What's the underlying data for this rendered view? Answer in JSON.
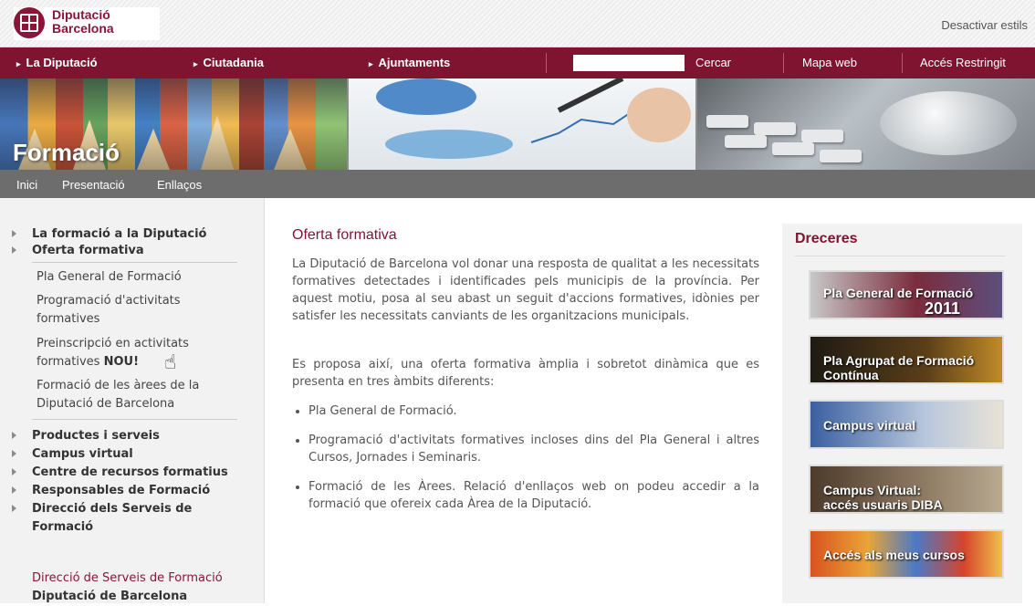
{
  "header": {
    "logo_line1": "Diputació",
    "logo_line2": "Barcelona",
    "desactivar": "Desactivar estils"
  },
  "nav": {
    "items": [
      "La Diputació",
      "Ciutadania",
      "Ajuntaments"
    ],
    "search_label": "Cercar",
    "mapa": "Mapa web",
    "acces": "Accés Restringit"
  },
  "banner": {
    "title": "Formació"
  },
  "subnav": [
    "Inici",
    "Presentació",
    "Enllaços"
  ],
  "sidebar": {
    "top": [
      "La formació a la Diputació",
      "Oferta formativa"
    ],
    "sub": [
      "Pla General de Formació",
      "Programació d'activitats",
      "formatives",
      "Preinscripció en activitats",
      "formatives",
      "NOU!",
      "Formació de les àrees de la",
      "Diputació de Barcelona"
    ],
    "more": [
      "Productes i serveis",
      "Campus virtual",
      "Centre de recursos formatius",
      "Responsables de Formació",
      "Direcció dels Serveis de",
      "Formació"
    ],
    "footer1": "Direcció de Serveis de Formació",
    "footer2": "Diputació de Barcelona"
  },
  "main": {
    "title": "Oferta formativa",
    "p1": "La Diputació de Barcelona vol donar una resposta de qualitat a les necessitats formatives detectades i identificades pels municipis de la província. Per aquest motiu, posa al seu abast un seguit d'accions formatives, idònies per satisfer les necessitats canviants de les organitzacions municipals.",
    "p2": "Es proposa així, una oferta formativa àmplia i sobretot dinàmica que es presenta en tres àmbits diferents:",
    "bullets": [
      "Pla General de Formació.",
      "Programació d'activitats formatives incloses dins del Pla General i altres Cursos, Jornades i Seminaris.",
      "Formació de les Àrees. Relació d'enllaços web on podeu accedir a la formació que ofereix cada Àrea de la Diputació."
    ]
  },
  "dreceres": {
    "title": "Dreceres",
    "buttons": [
      {
        "line1": "Pla General de Formació",
        "line2": "2011"
      },
      {
        "line1": "Pla Agrupat de Formació",
        "line2": "Contínua"
      },
      {
        "line1": "Campus virtual",
        "line2": ""
      },
      {
        "line1": "Campus Virtual:",
        "line2": "accés usuaris DIBA"
      },
      {
        "line1": "Accés als meus cursos",
        "line2": ""
      }
    ]
  },
  "colors": {
    "brand": "#7f1431",
    "grey_bar": "#6d6d6d"
  }
}
